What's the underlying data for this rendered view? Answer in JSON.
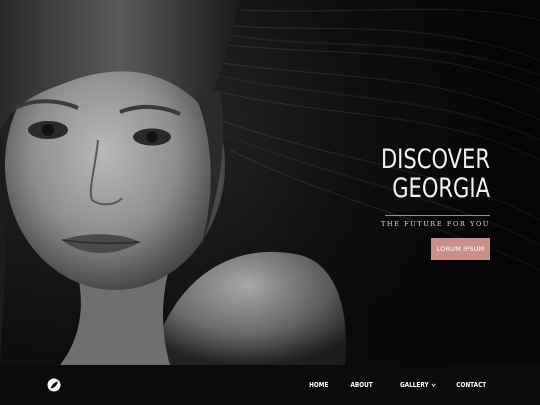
{
  "hero": {
    "title_line1": "DISCOVER",
    "title_line2": "GEORGIA",
    "subtitle": "THE FUTURE FOR YOU",
    "button_label": "LORUM IPSUM",
    "photo_icon": "portrait-photo",
    "accent_color": "#c98f8a"
  },
  "nav": {
    "logo_icon": "circle-logo-icon",
    "items": [
      {
        "label": "HOME"
      },
      {
        "label": "ABOUT"
      },
      {
        "label": "GALLERY",
        "icon": "chevron-down-icon"
      },
      {
        "label": "CONTACT"
      }
    ]
  }
}
